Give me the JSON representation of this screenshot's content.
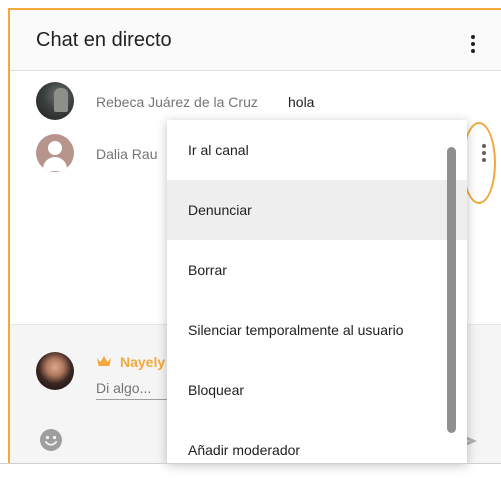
{
  "header": {
    "title": "Chat en directo",
    "menu_icon": "more-vert-icon"
  },
  "messages": [
    {
      "author": "Rebeca Juárez de la Cruz",
      "text": "hola",
      "avatar": "photo"
    },
    {
      "author": "Dalia Rau",
      "text": "",
      "avatar": "default-person-icon"
    }
  ],
  "context_menu": {
    "items": [
      {
        "label": "Ir al canal"
      },
      {
        "label": "Denunciar",
        "highlighted": true
      },
      {
        "label": "Borrar"
      },
      {
        "label": "Silenciar temporalmente al usuario"
      },
      {
        "label": "Bloquear"
      },
      {
        "label": "Añadir moderador"
      }
    ]
  },
  "composer": {
    "user_name": "Nayely",
    "badge_icon": "crown-icon",
    "placeholder": "Di algo...",
    "emoji_icon": "emoji-icon",
    "send_icon": "send-icon"
  },
  "colors": {
    "accent": "#f2a93b",
    "menu_highlight": "#eeeeee"
  }
}
